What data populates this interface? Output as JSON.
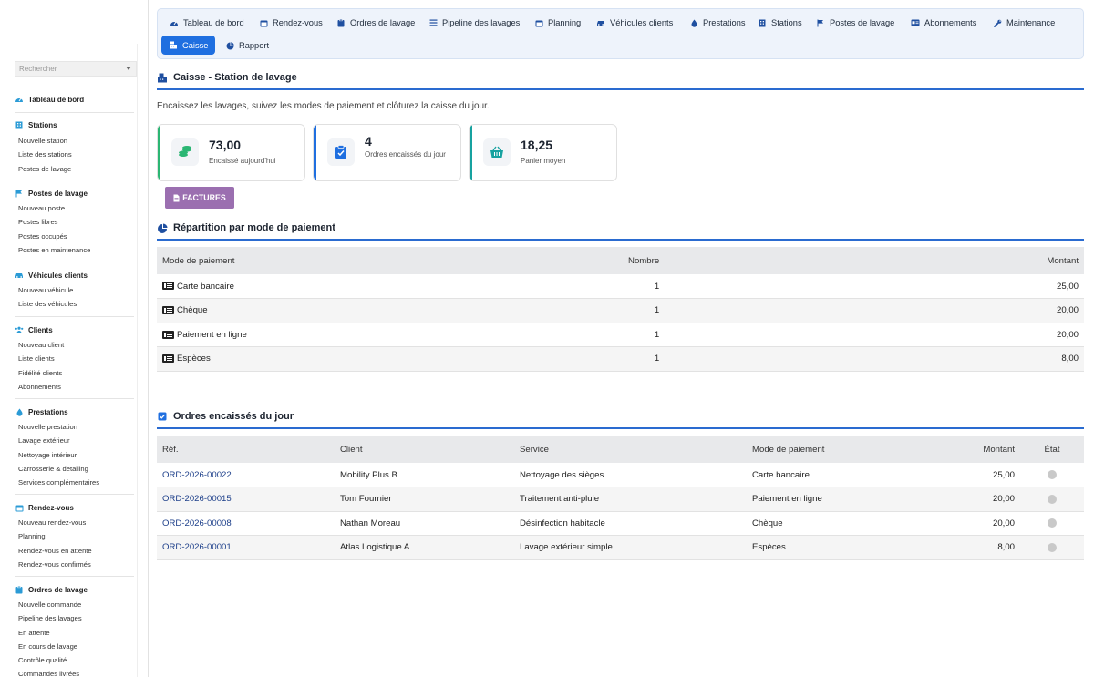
{
  "sidebar": {
    "search_placeholder": "Rechercher",
    "sections": [
      {
        "title": "Tableau de bord",
        "icon": "dashboard-icon",
        "links": []
      },
      {
        "title": "Stations",
        "icon": "building-icon",
        "links": [
          "Nouvelle station",
          "Liste des stations",
          "Postes de lavage"
        ]
      },
      {
        "title": "Postes de lavage",
        "icon": "flag-icon",
        "links": [
          "Nouveau poste",
          "Postes libres",
          "Postes occupés",
          "Postes en maintenance"
        ]
      },
      {
        "title": "Véhicules clients",
        "icon": "car-icon",
        "links": [
          "Nouveau véhicule",
          "Liste des véhicules"
        ]
      },
      {
        "title": "Clients",
        "icon": "users-icon",
        "links": [
          "Nouveau client",
          "Liste clients",
          "Fidélité clients",
          "Abonnements"
        ]
      },
      {
        "title": "Prestations",
        "icon": "drop-icon",
        "links": [
          "Nouvelle prestation",
          "Lavage extérieur",
          "Nettoyage intérieur",
          "Carrosserie & detailing",
          "Services complémentaires"
        ]
      },
      {
        "title": "Rendez-vous",
        "icon": "calendar-icon",
        "links": [
          "Nouveau rendez-vous",
          "Planning",
          "Rendez-vous en attente",
          "Rendez-vous confirmés"
        ]
      },
      {
        "title": "Ordres de lavage",
        "icon": "clipboard-icon",
        "links": [
          "Nouvelle commande",
          "Pipeline des lavages",
          "En attente",
          "En cours de lavage",
          "Contrôle qualité",
          "Commandes livrées"
        ]
      }
    ]
  },
  "topnav": {
    "items": [
      {
        "label": "Tableau de bord",
        "icon": "dashboard-icon"
      },
      {
        "label": "Rendez-vous",
        "icon": "calendar-icon"
      },
      {
        "label": "Ordres de lavage",
        "icon": "clipboard-icon"
      },
      {
        "label": "Pipeline des lavages",
        "icon": "list-icon"
      },
      {
        "label": "Planning",
        "icon": "calendar-icon"
      },
      {
        "label": "Véhicules clients",
        "icon": "car-icon"
      },
      {
        "label": "Prestations",
        "icon": "drop-icon"
      },
      {
        "label": "Stations",
        "icon": "building-icon"
      },
      {
        "label": "Postes de lavage",
        "icon": "flag-icon"
      },
      {
        "label": "Abonnements",
        "icon": "card-icon"
      },
      {
        "label": "Maintenance",
        "icon": "wrench-icon"
      },
      {
        "label": "Caisse",
        "icon": "cash-register-icon",
        "active": true
      },
      {
        "label": "Rapport",
        "icon": "pie-icon"
      }
    ]
  },
  "page": {
    "title": "Caisse - Station de lavage",
    "intro": "Encaissez les lavages, suivez les modes de paiement et clôturez la caisse du jour."
  },
  "kpis": [
    {
      "value": "73,00",
      "label": "Encaissé aujourd'hui",
      "color": "#2bb673",
      "icon": "coins-icon"
    },
    {
      "value": "4",
      "label": "Ordres encaissés du jour",
      "color": "#1f6fe0",
      "icon": "clipboard-check-icon"
    },
    {
      "value": "18,25",
      "label": "Panier moyen",
      "color": "#17a2a0",
      "icon": "basket-icon"
    }
  ],
  "factures_label": "FACTURES",
  "payment": {
    "title": "Répartition par mode de paiement",
    "headers": {
      "mode": "Mode de paiement",
      "count": "Nombre",
      "amount": "Montant"
    },
    "rows": [
      {
        "mode": "Carte bancaire",
        "count": "1",
        "amount": "25,00"
      },
      {
        "mode": "Chèque",
        "count": "1",
        "amount": "20,00"
      },
      {
        "mode": "Paiement en ligne",
        "count": "1",
        "amount": "20,00"
      },
      {
        "mode": "Espèces",
        "count": "1",
        "amount": "8,00"
      }
    ]
  },
  "orders": {
    "title": "Ordres encaissés du jour",
    "headers": {
      "ref": "Réf.",
      "client": "Client",
      "service": "Service",
      "mode": "Mode de paiement",
      "amount": "Montant",
      "state": "État"
    },
    "rows": [
      {
        "ref": "ORD-2026-00022",
        "client": "Mobility Plus B",
        "service": "Nettoyage des sièges",
        "mode": "Carte bancaire",
        "amount": "25,00"
      },
      {
        "ref": "ORD-2026-00015",
        "client": "Tom Fournier",
        "service": "Traitement anti-pluie",
        "mode": "Paiement en ligne",
        "amount": "20,00"
      },
      {
        "ref": "ORD-2026-00008",
        "client": "Nathan Moreau",
        "service": "Désinfection habitacle",
        "mode": "Chèque",
        "amount": "20,00"
      },
      {
        "ref": "ORD-2026-00001",
        "client": "Atlas Logistique A",
        "service": "Lavage extérieur simple",
        "mode": "Espèces",
        "amount": "8,00"
      }
    ]
  }
}
